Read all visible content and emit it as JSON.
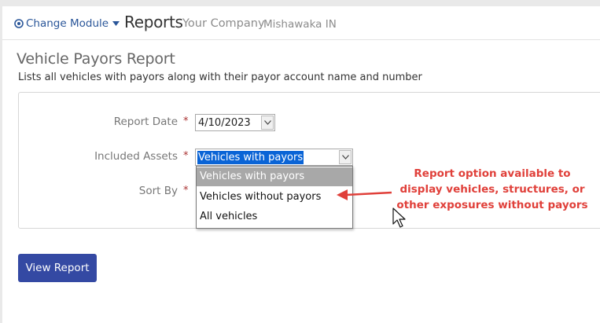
{
  "header": {
    "module_switch_label": "Change Module",
    "title": "Reports",
    "company_name": "Your Company",
    "company_location": "Mishawaka IN"
  },
  "report": {
    "title": "Vehicle Payors Report",
    "description": "Lists all vehicles with payors along with their payor account name and number"
  },
  "form": {
    "required_mark": "*",
    "report_date": {
      "label": "Report Date",
      "value": "4/10/2023"
    },
    "included_assets": {
      "label": "Included Assets",
      "value": "Vehicles with payors",
      "options": [
        "Vehicles with payors",
        "Vehicles without payors",
        "All vehicles"
      ]
    },
    "sort_by": {
      "label": "Sort By"
    }
  },
  "annotation": {
    "text_lines": [
      "Report option available to",
      "display vehicles, structures, or",
      "other exposures without payors"
    ],
    "color": "#e0403a"
  },
  "actions": {
    "view_report_label": "View Report"
  },
  "colors": {
    "primary_button": "#3449a3",
    "link": "#2a5699",
    "selection": "#0a64d6"
  },
  "icons": {
    "module_switch": "globe-icon",
    "dropdown": "chevron-down-icon",
    "cursor": "mouse-pointer-icon"
  }
}
